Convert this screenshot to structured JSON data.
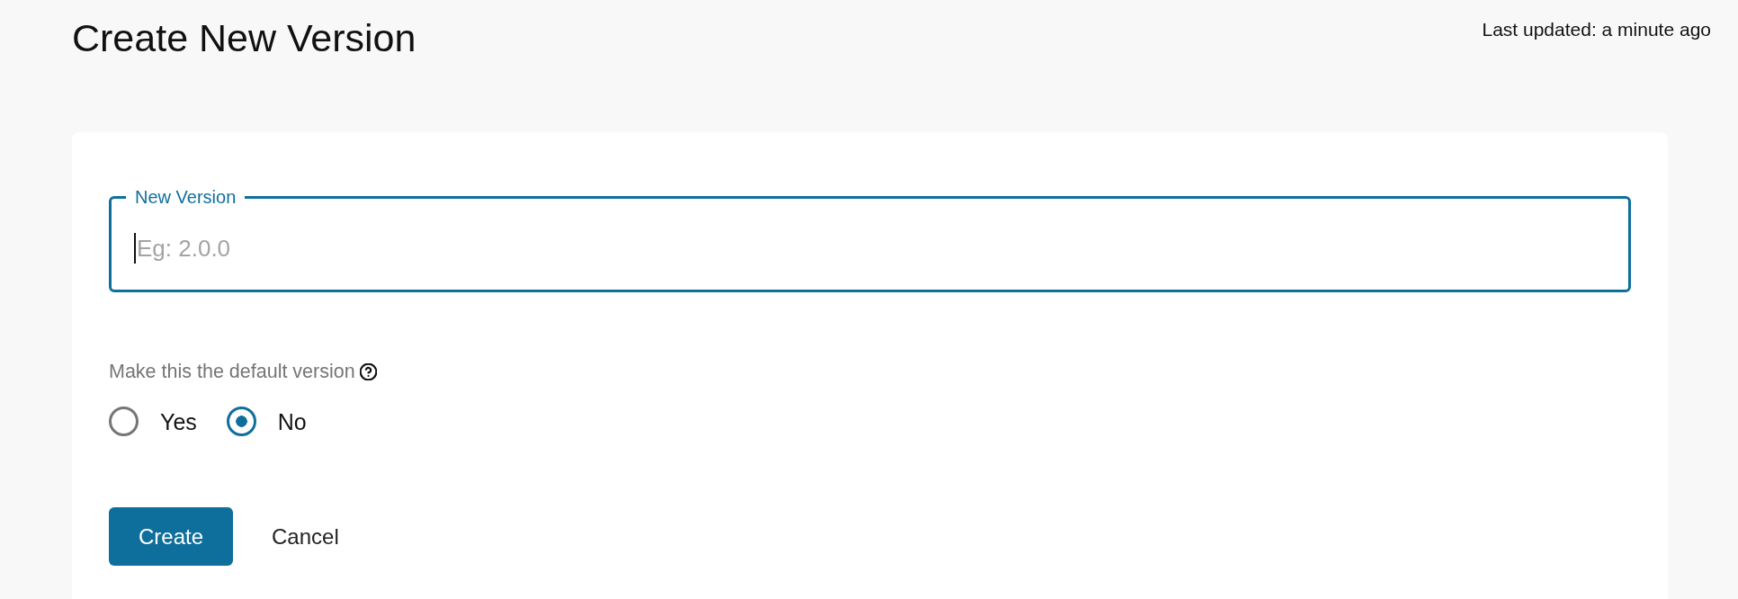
{
  "header": {
    "title": "Create New Version",
    "last_updated": "Last updated: a minute ago"
  },
  "form": {
    "version_field": {
      "label": "New Version",
      "placeholder": "Eg: 2.0.0",
      "focused": true
    },
    "default_version": {
      "label": "Make this the default version",
      "options": [
        {
          "label": "Yes",
          "selected": false
        },
        {
          "label": "No",
          "selected": true
        }
      ]
    },
    "buttons": [
      {
        "label": "Create",
        "kind": "primary"
      },
      {
        "label": "Cancel",
        "kind": "secondary"
      }
    ]
  }
}
